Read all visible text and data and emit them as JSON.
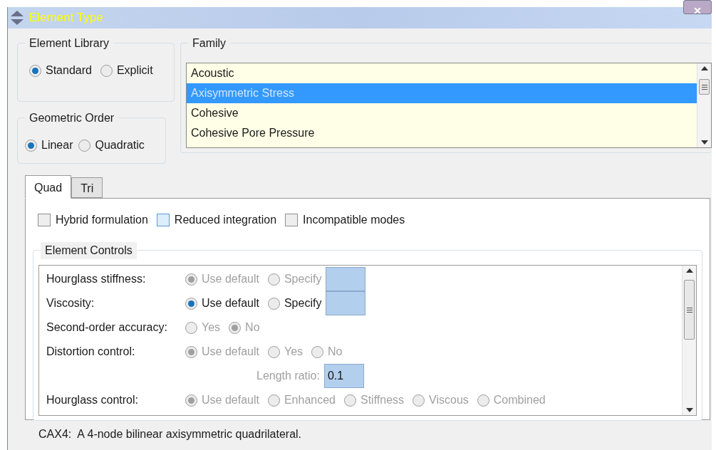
{
  "window": {
    "title": "Element Type"
  },
  "element_library": {
    "label": "Element Library",
    "options": [
      {
        "label": "Standard",
        "selected": true
      },
      {
        "label": "Explicit",
        "selected": false
      }
    ]
  },
  "geometric_order": {
    "label": "Geometric Order",
    "options": [
      {
        "label": "Linear",
        "selected": true
      },
      {
        "label": "Quadratic",
        "selected": false
      }
    ]
  },
  "family": {
    "label": "Family",
    "items": [
      {
        "label": "Acoustic",
        "selected": false
      },
      {
        "label": "Axisymmetric Stress",
        "selected": true
      },
      {
        "label": "Cohesive",
        "selected": false
      },
      {
        "label": "Cohesive Pore Pressure",
        "selected": false
      }
    ]
  },
  "tabs": [
    {
      "label": "Quad",
      "selected": true
    },
    {
      "label": "Tri",
      "selected": false
    }
  ],
  "options": [
    {
      "label": "Hybrid formulation",
      "checked": false,
      "highlighted": false
    },
    {
      "label": "Reduced integration",
      "checked": false,
      "highlighted": true
    },
    {
      "label": "Incompatible modes",
      "checked": false,
      "highlighted": false
    }
  ],
  "element_controls": {
    "label": "Element Controls",
    "rows": [
      {
        "kind": "radios_field",
        "label": "Hourglass stiffness:",
        "disabled": true,
        "options": [
          {
            "label": "Use default",
            "selected": true
          },
          {
            "label": "Specify",
            "selected": false
          }
        ]
      },
      {
        "kind": "radios_field",
        "label": "Viscosity:",
        "disabled": false,
        "options": [
          {
            "label": "Use default",
            "selected": true
          },
          {
            "label": "Specify",
            "selected": false
          }
        ]
      },
      {
        "kind": "radios",
        "label": "Second-order accuracy:",
        "disabled": true,
        "options": [
          {
            "label": "Yes",
            "selected": false
          },
          {
            "label": "No",
            "selected": true
          }
        ]
      },
      {
        "kind": "radios",
        "label": "Distortion control:",
        "disabled": true,
        "options": [
          {
            "label": "Use default",
            "selected": true
          },
          {
            "label": "Yes",
            "selected": false
          },
          {
            "label": "No",
            "selected": false
          }
        ]
      },
      {
        "kind": "field",
        "label": "Length ratio:",
        "disabled": true,
        "value": "0.1"
      },
      {
        "kind": "radios",
        "label": "Hourglass control:",
        "disabled": true,
        "options": [
          {
            "label": "Use default",
            "selected": true
          },
          {
            "label": "Enhanced",
            "selected": false
          },
          {
            "label": "Stiffness",
            "selected": false
          },
          {
            "label": "Viscous",
            "selected": false
          },
          {
            "label": "Combined",
            "selected": false
          }
        ]
      }
    ]
  },
  "description": "CAX4:  A 4-node bilinear axisymmetric quadrilateral."
}
